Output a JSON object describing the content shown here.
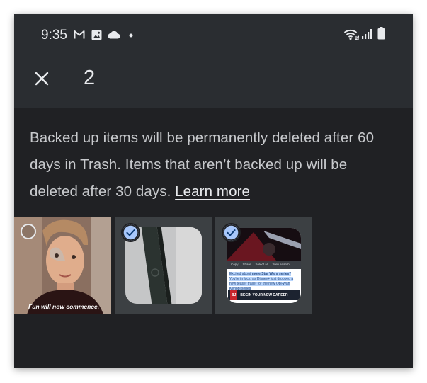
{
  "status_bar": {
    "time": "9:35",
    "left_icons": [
      "gmail-icon",
      "photos-icon",
      "cloud-icon",
      "notification-dot-icon"
    ],
    "right_icons": [
      "wifi-icon",
      "signal-icon",
      "battery-icon"
    ]
  },
  "toolbar": {
    "close_icon": "close-icon",
    "selected_count": "2"
  },
  "info": {
    "message": "Backed up items will be permanently deleted after 60 days in Trash. Items that aren’t backed up will be deleted after 30 days. ",
    "link": "Learn more"
  },
  "thumbnails": [
    {
      "selected": false,
      "caption": "Fun will now commence."
    },
    {
      "selected": true
    },
    {
      "selected": true,
      "menu": [
        "Copy",
        "Share",
        "Select all",
        "Web search"
      ],
      "text_before": "Excited about ",
      "text_bold": "more Star Wars series",
      "text_after": "? You're in luck, as Disney+ just dropped a new teaser trailer for the new Obi-Wan Kenobi series",
      "ad_logo": "BJ",
      "ad_text": "BEGIN YOUR NEW CAREER TODAY"
    }
  ],
  "colors": {
    "background": "#202124",
    "header": "#2a2d31",
    "text": "#c7c9cc",
    "accent_check": "#a8c7fa",
    "selected_tile": "#3c4043"
  }
}
